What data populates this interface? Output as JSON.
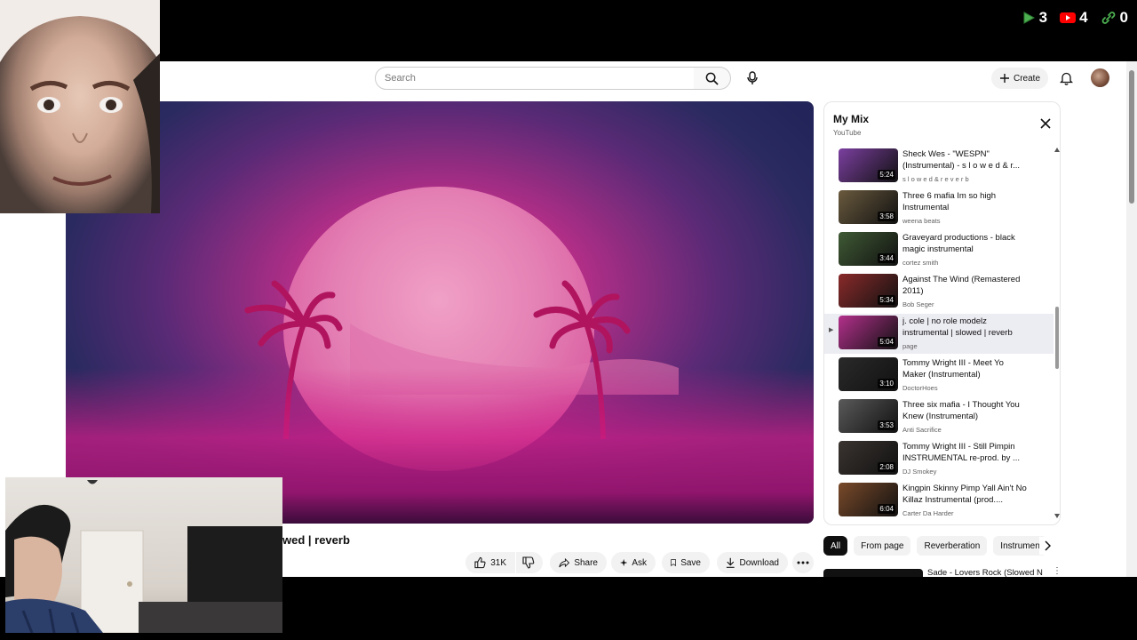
{
  "overlay": {
    "counters": [
      {
        "icon": "green-play-icon",
        "value": "3",
        "color": "#4caf50"
      },
      {
        "icon": "youtube-icon",
        "value": "4",
        "color": "#ff0000"
      },
      {
        "icon": "link-icon",
        "value": "0",
        "color": "#4caf50"
      }
    ]
  },
  "header": {
    "search_placeholder": "Search",
    "create_label": "Create"
  },
  "video": {
    "title_visible": "wed | reverb",
    "likes": "31K",
    "actions": {
      "share": "Share",
      "ask": "Ask",
      "save": "Save",
      "download": "Download"
    }
  },
  "mix": {
    "title": "My Mix",
    "subtitle": "YouTube",
    "items": [
      {
        "title": "Sheck Wes - \"WESPN\" (Instrumental) - s l o w e d & r...",
        "channel": "s l o w e d & r e v e r b",
        "duration": "5:24",
        "thumb": "#7b3fa0"
      },
      {
        "title": "Three 6 mafia Im so high Instrumental",
        "channel": "weena beats",
        "duration": "3:58",
        "thumb": "#6a5a3e"
      },
      {
        "title": "Graveyard productions - black magic instrumental",
        "channel": "cortez smith",
        "duration": "3:44",
        "thumb": "#3f5a34"
      },
      {
        "title": "Against The Wind (Remastered 2011)",
        "channel": "Bob Seger",
        "duration": "5:34",
        "thumb": "#8a2a2a"
      },
      {
        "title": "j. cole | no role modelz instrumental | slowed | reverb",
        "channel": "page",
        "duration": "5:04",
        "thumb": "#b3308c",
        "active": true
      },
      {
        "title": "Tommy Wright III - Meet Yo Maker (Instrumental)",
        "channel": "DoctorHoes",
        "duration": "3:10",
        "thumb": "#2a2a2a"
      },
      {
        "title": "Three six mafia - I Thought You Knew (Instrumental)",
        "channel": "Anti Sacrifice",
        "duration": "3:53",
        "thumb": "#5a5a5a"
      },
      {
        "title": "Tommy Wright III - Still Pimpin INSTRUMENTAL re-prod. by ...",
        "channel": "DJ Smokey",
        "duration": "2:08",
        "thumb": "#3a3430"
      },
      {
        "title": "Kingpin Skinny Pimp Yall Ain't No Killaz Instrumental (prod....",
        "channel": "Carter Da Harder",
        "duration": "6:04",
        "thumb": "#7a4a2a"
      }
    ]
  },
  "chips": [
    "All",
    "From page",
    "Reverberation",
    "Instrumen"
  ],
  "recommended": {
    "title": "Sade - Lovers Rock (Slowed N"
  }
}
